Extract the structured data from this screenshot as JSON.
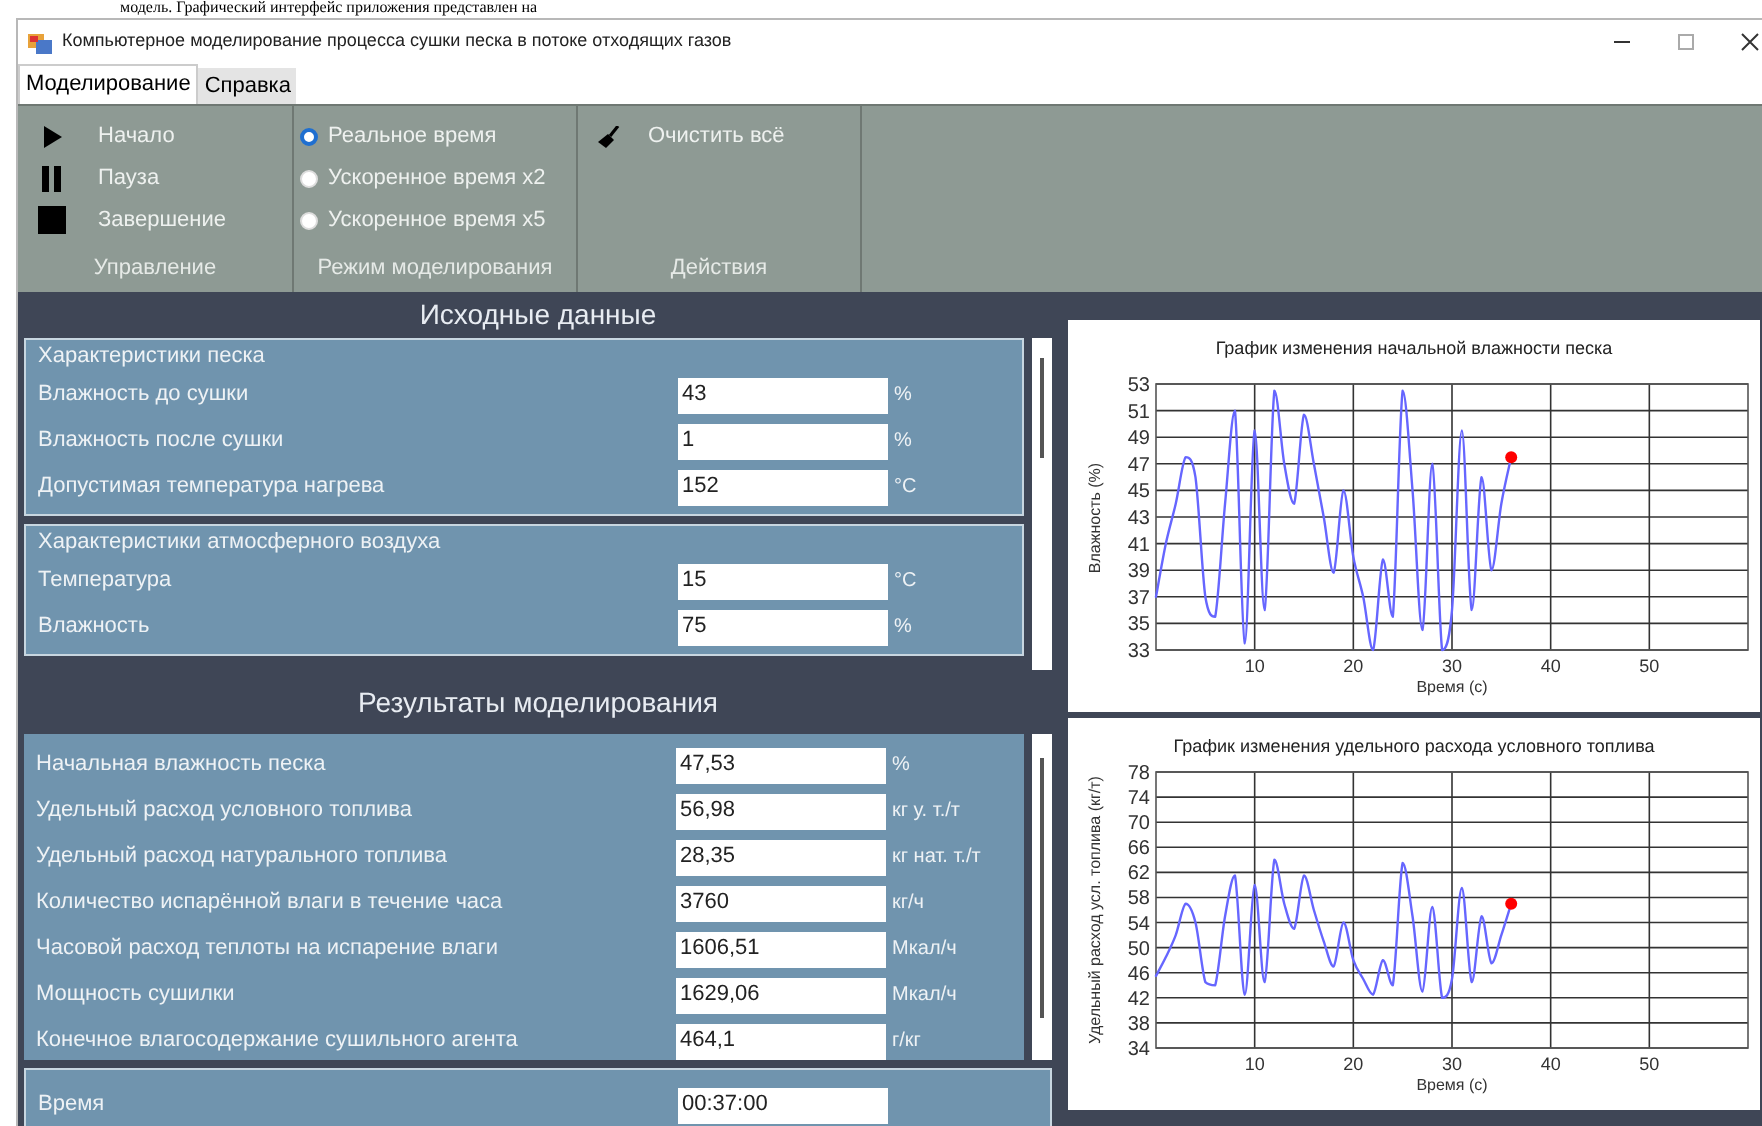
{
  "document_text": "модель. Графический интерфейс приложения представлен на",
  "window": {
    "title": "Компьютерное моделирование процесса сушки песка в потоке отходящих газов"
  },
  "menu": [
    {
      "label": "Моделирование",
      "selected": true
    },
    {
      "label": "Справка",
      "selected": false
    }
  ],
  "ribbon": [
    {
      "label": "Управление",
      "kind": "buttons",
      "items": [
        {
          "label": "Начало"
        },
        {
          "label": "Пауза"
        },
        {
          "label": "Завершение"
        }
      ]
    },
    {
      "label": "Режим моделирования",
      "kind": "radios",
      "items": [
        {
          "label": "Реальное время",
          "selected": true
        },
        {
          "label": "Ускоренное время x2",
          "selected": false
        },
        {
          "label": "Ускоренное время x5",
          "selected": false
        }
      ]
    },
    {
      "label": "Действия",
      "kind": "actions",
      "items": [
        {
          "label": "Очистить всё"
        }
      ]
    }
  ],
  "input_header": "Исходные данные",
  "input_groups": [
    {
      "title": "Характеристики песка",
      "fields": [
        {
          "label": "Влажность до сушки",
          "value": "43",
          "unit": "%"
        },
        {
          "label": "Влажность после сушки",
          "value": "1",
          "unit": "%"
        },
        {
          "label": "Допустимая температура нагрева",
          "value": "152",
          "unit": "°C"
        }
      ]
    },
    {
      "title": "Характеристики атмосферного воздуха",
      "fields": [
        {
          "label": "Температура",
          "value": "15",
          "unit": "°C"
        },
        {
          "label": "Влажность",
          "value": "75",
          "unit": "%"
        }
      ]
    }
  ],
  "results_header": "Результаты моделирования",
  "results": [
    {
      "label": "Начальная влажность песка",
      "value": "47,53",
      "unit": "%"
    },
    {
      "label": "Удельный расход условного топлива",
      "value": "56,98",
      "unit": "кг у. т./т"
    },
    {
      "label": "Удельный расход натурального топлива",
      "value": "28,35",
      "unit": "кг нат. т./т"
    },
    {
      "label": "Количество испарённой влаги в течение часа",
      "value": "3760",
      "unit": "кг/ч"
    },
    {
      "label": "Часовой расход теплоты на испарение влаги",
      "value": "1606,51",
      "unit": "Мкал/ч"
    },
    {
      "label": "Мощность сушилки",
      "value": "1629,06",
      "unit": "Мкал/ч"
    },
    {
      "label": "Конечное влагосодержание сушильного агента",
      "value": "464,1",
      "unit": "г/кг"
    }
  ],
  "time": {
    "label": "Время",
    "value": "00:37:00"
  },
  "charts": [
    {
      "chart_data": {
        "type": "line",
        "title": "График изменения начальной влажности песка",
        "xlabel": "Время (с)",
        "ylabel": "Влажность (%)",
        "x": [
          0,
          1,
          2,
          3,
          4,
          5,
          6,
          7,
          8,
          9,
          10,
          11,
          12,
          13,
          14,
          15,
          16,
          17,
          18,
          19,
          20,
          21,
          22,
          23,
          24,
          25,
          26,
          27,
          28,
          29,
          30,
          31,
          32,
          33,
          34,
          35,
          36
        ],
        "grid": true,
        "series": [
          {
            "color": "#6666ff",
            "values": [
              37,
              41,
              44,
              47.5,
              46,
              37,
              35.5,
              44,
              51,
              33.5,
              49.5,
              36,
              52.5,
              47,
              44,
              50.7,
              47,
              43,
              38.8,
              45,
              40,
              37,
              33,
              39.8,
              35.5,
              52.5,
              45,
              34.5,
              47,
              33,
              36,
              49.5,
              36,
              46,
              39,
              44,
              47.5
            ]
          }
        ],
        "xlim": [
          0,
          60
        ],
        "ylim": [
          33,
          53
        ],
        "xticks": [
          10,
          20,
          30,
          40,
          50
        ],
        "yticks": [
          33,
          35,
          37,
          39,
          41,
          43,
          45,
          47,
          49,
          51,
          53
        ]
      }
    },
    {
      "chart_data": {
        "type": "line",
        "title": "График изменения удельного расхода условного топлива",
        "xlabel": "Время (с)",
        "ylabel": "Удельный расход усл. топлива (кг/т)",
        "x": [
          0,
          1,
          2,
          3,
          4,
          5,
          6,
          7,
          8,
          9,
          10,
          11,
          12,
          13,
          14,
          15,
          16,
          17,
          18,
          19,
          20,
          21,
          22,
          23,
          24,
          25,
          26,
          27,
          28,
          29,
          30,
          31,
          32,
          33,
          34,
          35,
          36
        ],
        "grid": true,
        "series": [
          {
            "color": "#6666ff",
            "values": [
              45.5,
              48.5,
              52,
              57,
              54,
              44.5,
              44,
              55,
              61.5,
              42.5,
              60,
              44.5,
              64,
              57,
              53,
              61.5,
              56,
              51,
              47,
              54,
              48,
              45,
              42.5,
              48,
              44,
              63.5,
              55,
              43,
              56.5,
              42,
              45,
              59.5,
              44.5,
              55,
              47.5,
              52,
              57
            ]
          }
        ],
        "xlim": [
          0,
          60
        ],
        "ylim": [
          34,
          78
        ],
        "xticks": [
          10,
          20,
          30,
          40,
          50
        ],
        "yticks": [
          34,
          38,
          42,
          46,
          50,
          54,
          58,
          62,
          66,
          70,
          74,
          78
        ]
      }
    }
  ]
}
